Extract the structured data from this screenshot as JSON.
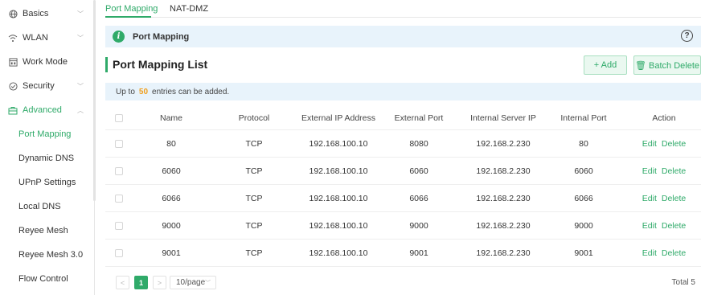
{
  "sidebar": {
    "items": [
      {
        "label": "Basics",
        "icon": "globe-icon",
        "chevron": "down"
      },
      {
        "label": "WLAN",
        "icon": "wifi-icon",
        "chevron": "down"
      },
      {
        "label": "Work Mode",
        "icon": "workmode-icon",
        "chevron": ""
      },
      {
        "label": "Security",
        "icon": "shield-icon",
        "chevron": "down"
      },
      {
        "label": "Advanced",
        "icon": "briefcase-icon",
        "chevron": "up"
      },
      {
        "label": "Port Mapping"
      },
      {
        "label": "Dynamic DNS"
      },
      {
        "label": "UPnP Settings"
      },
      {
        "label": "Local DNS"
      },
      {
        "label": "Reyee Mesh"
      },
      {
        "label": "Reyee Mesh 3.0"
      },
      {
        "label": "Flow Control"
      }
    ]
  },
  "tabs": [
    {
      "label": "Port Mapping",
      "active": true
    },
    {
      "label": "NAT-DMZ",
      "active": false
    }
  ],
  "infobar": {
    "title": "Port Mapping",
    "info_glyph": "i",
    "help_glyph": "?"
  },
  "list": {
    "title": "Port Mapping List",
    "add_label": "+ Add",
    "batch_delete_label": "🗑 Batch Delete"
  },
  "note": {
    "prefix": "Up to",
    "count": "50",
    "suffix": "entries can be added."
  },
  "table": {
    "headers": [
      "Name",
      "Protocol",
      "External IP Address",
      "External Port",
      "Internal Server IP",
      "Internal Port",
      "Action"
    ],
    "rows": [
      {
        "name": "80",
        "protocol": "TCP",
        "ext_ip": "192.168.100.10",
        "ext_port": "8080",
        "int_ip": "192.168.2.230",
        "int_port": "80"
      },
      {
        "name": "6060",
        "protocol": "TCP",
        "ext_ip": "192.168.100.10",
        "ext_port": "6060",
        "int_ip": "192.168.2.230",
        "int_port": "6060"
      },
      {
        "name": "6066",
        "protocol": "TCP",
        "ext_ip": "192.168.100.10",
        "ext_port": "6066",
        "int_ip": "192.168.2.230",
        "int_port": "6066"
      },
      {
        "name": "9000",
        "protocol": "TCP",
        "ext_ip": "192.168.100.10",
        "ext_port": "9000",
        "int_ip": "192.168.2.230",
        "int_port": "9000"
      },
      {
        "name": "9001",
        "protocol": "TCP",
        "ext_ip": "192.168.100.10",
        "ext_port": "9001",
        "int_ip": "192.168.2.230",
        "int_port": "9001"
      }
    ],
    "edit_label": "Edit",
    "delete_label": "Delete"
  },
  "pagination": {
    "prev": "<",
    "current_page": "1",
    "next": ">",
    "page_size": "10/page",
    "total": "Total 5"
  },
  "colors": {
    "accent": "#2faa69",
    "info_bg": "#e8f3fb",
    "count_highlight": "#f0a020"
  }
}
